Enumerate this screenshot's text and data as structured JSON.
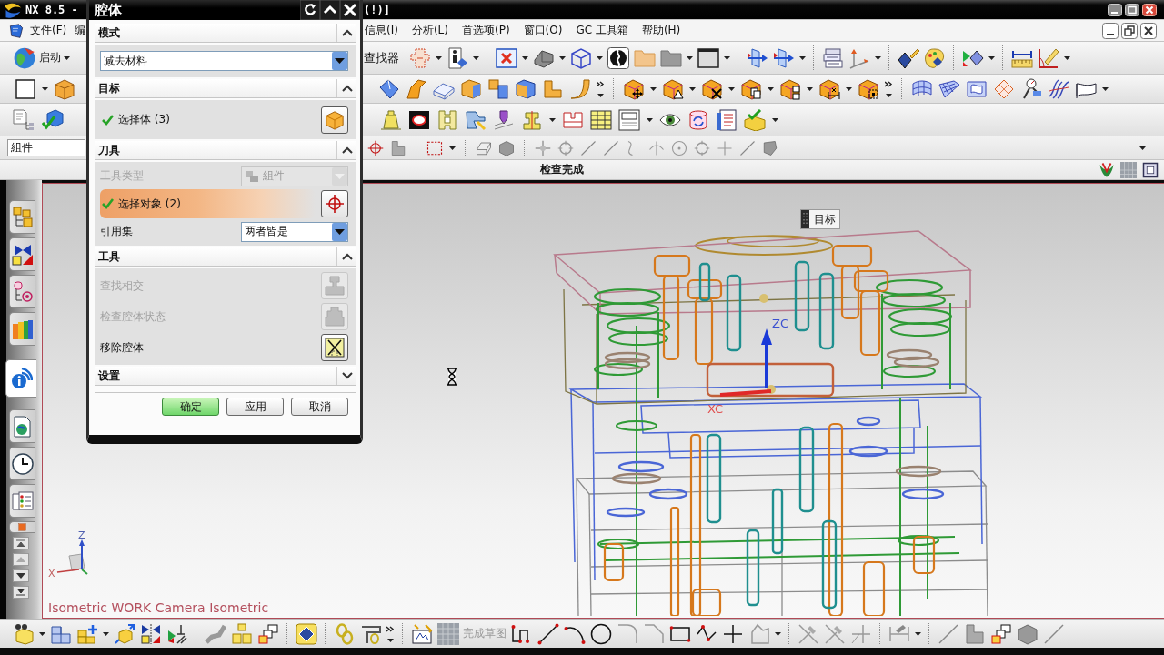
{
  "app_window": {
    "title": "NX 8.5 -",
    "title_tail": "(!)]"
  },
  "menu_bar": [
    {
      "label": "文件(F)"
    },
    {
      "label": "编"
    },
    {
      "label": "信息(I)"
    },
    {
      "label": "分析(L)"
    },
    {
      "label": "首选项(P)"
    },
    {
      "label": "窗口(O)"
    },
    {
      "label": "GC 工具箱"
    },
    {
      "label": "帮助(H)"
    }
  ],
  "toolbar": {
    "start_button": "启动",
    "command_finder": "查找器",
    "selection_filter": "組件"
  },
  "status_bar": {
    "message": "检查完成"
  },
  "resource_bar": {
    "tabs": [
      {
        "selected": false
      },
      {
        "selected": false
      },
      {
        "selected": false
      },
      {
        "selected": false
      },
      {
        "selected": true
      },
      {
        "selected": false
      },
      {
        "selected": false
      },
      {
        "selected": false
      },
      {
        "selected": false
      }
    ]
  },
  "viewport": {
    "tooltip": "目标",
    "csys_labels": [
      "ZC",
      "XC"
    ],
    "triad_labels": [
      "Z",
      "X"
    ],
    "view_label": "Isometric WORK Camera Isometric"
  },
  "dialog": {
    "title": "腔体",
    "sections": [
      {
        "title": "模式",
        "expanded": true,
        "rows": [
          {
            "kind": "select",
            "value": "减去材料",
            "disabled": false
          }
        ]
      },
      {
        "title": "目标",
        "expanded": true,
        "rows": [
          {
            "kind": "selection",
            "label": "选择体 (3)",
            "complete": true,
            "active": false,
            "disabled": false
          }
        ]
      },
      {
        "title": "刀具",
        "expanded": true,
        "rows": [
          {
            "kind": "labeled_select",
            "label": "工具类型",
            "value": "組件",
            "disabled": true
          },
          {
            "kind": "selection",
            "label": "选择对象 (2)",
            "complete": true,
            "active": true,
            "disabled": false
          },
          {
            "kind": "labeled_select",
            "label": "引用集",
            "value": "两者皆是",
            "disabled": false
          }
        ]
      },
      {
        "title": "工具",
        "expanded": true,
        "rows": [
          {
            "kind": "action",
            "label": "查找相交",
            "disabled": true
          },
          {
            "kind": "action",
            "label": "检查腔体状态",
            "disabled": true
          },
          {
            "kind": "action",
            "label": "移除腔体",
            "disabled": false
          }
        ]
      },
      {
        "title": "设置",
        "expanded": false
      }
    ],
    "buttons": [
      {
        "label": "确定",
        "default": true
      },
      {
        "label": "应用",
        "default": false
      },
      {
        "label": "取消",
        "default": false
      }
    ]
  },
  "bottom_toolbar": {
    "finish_sketch": {
      "label": "完成草图",
      "disabled": true
    }
  }
}
